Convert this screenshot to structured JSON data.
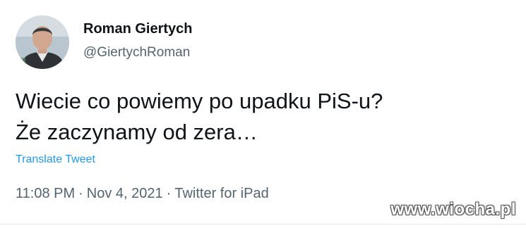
{
  "tweet": {
    "author_name": "Roman Giertych",
    "author_handle": "@GiertychRoman",
    "text_lines": [
      "Wiecie co powiemy po upadku PiS-u?",
      "Że zaczynamy od zera…"
    ],
    "translate_label": "Translate Tweet",
    "time": "11:08 PM",
    "date": "Nov 4, 2021",
    "source": "Twitter for iPad",
    "separator": "·"
  },
  "watermark": "www.wiocha.pl",
  "colors": {
    "text": "#0f1419",
    "secondary": "#536471",
    "link": "#1d9bf0"
  }
}
